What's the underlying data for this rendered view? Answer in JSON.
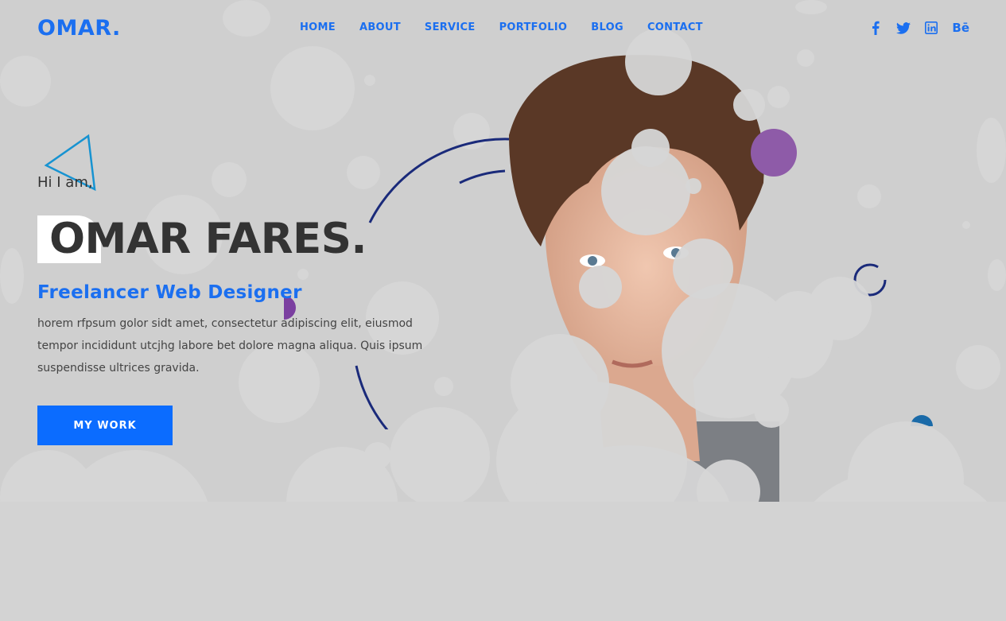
{
  "brand": {
    "logo": "OMAR."
  },
  "nav": {
    "items": [
      "HOME",
      "ABOUT",
      "SERVICE",
      "PORTFOLIO",
      "BLOG",
      "CONTACT"
    ]
  },
  "social": {
    "icons": [
      "facebook-icon",
      "twitter-icon",
      "linkedin-icon",
      "behance-icon"
    ],
    "behance_text": "Bē"
  },
  "hero": {
    "greeting": "Hi I am,",
    "name": "OMAR FARES.",
    "role": "Freelancer Web Designer",
    "description": "horem rfpsum golor sidt amet, consectetur adipiscing elit, eiusmod tempor incididunt utcjhg labore bet dolore magna aliqua. Quis ipsum suspendisse ultrices gravida.",
    "button_label": "MY WORK"
  },
  "colors": {
    "accent": "#1b6ff0",
    "button": "#0b6cff",
    "background": "#cfcfcf",
    "ring": "#1a2a7a",
    "purple": "#8e5ba8"
  }
}
